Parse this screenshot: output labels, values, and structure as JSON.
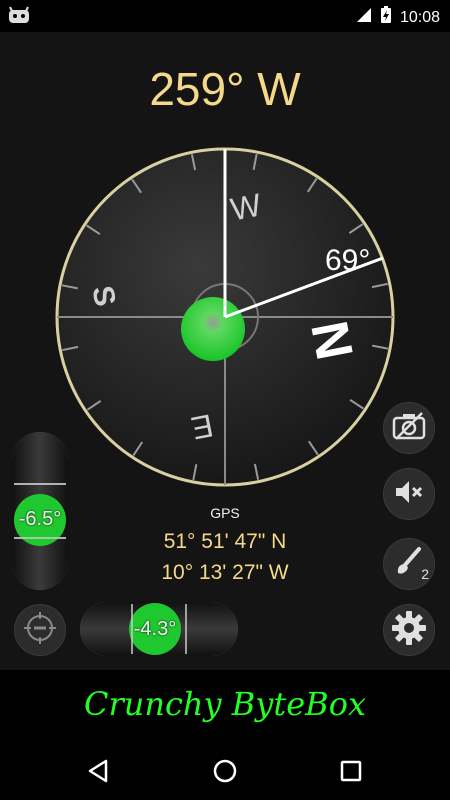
{
  "status_bar": {
    "time": "10:08",
    "app_icon": "android-robot-icon",
    "signal_icon": "cell-signal-icon",
    "battery_icon": "battery-charging-icon"
  },
  "compass": {
    "heading_text": "259° W",
    "heading_degrees": 259,
    "cardinal_labels": [
      "W",
      "N",
      "E",
      "S"
    ],
    "angle_label": "69°",
    "bubble_color": "#22cc33",
    "rim_color": "#d9d0a0"
  },
  "gps": {
    "label": "GPS",
    "latitude": "51° 51' 47\" N",
    "longitude": "10° 13' 27\" W"
  },
  "levels": {
    "vertical_value": "-6.5°",
    "horizontal_value": "-4.3°"
  },
  "buttons": {
    "camera_icon": "camera-off-icon",
    "sound_icon": "speaker-mute-icon",
    "brush_icon": "paintbrush-icon",
    "brush_badge": "2",
    "settings_icon": "gear-icon",
    "calibrate_icon": "crosshair-icon"
  },
  "banner": {
    "text": "Crunchy ByteBox",
    "color": "#22ff22"
  },
  "nav": {
    "back_icon": "back-triangle-icon",
    "home_icon": "home-circle-icon",
    "recents_icon": "recents-square-icon"
  },
  "colors": {
    "accent_text": "#f5d98a",
    "background": "#141414"
  }
}
